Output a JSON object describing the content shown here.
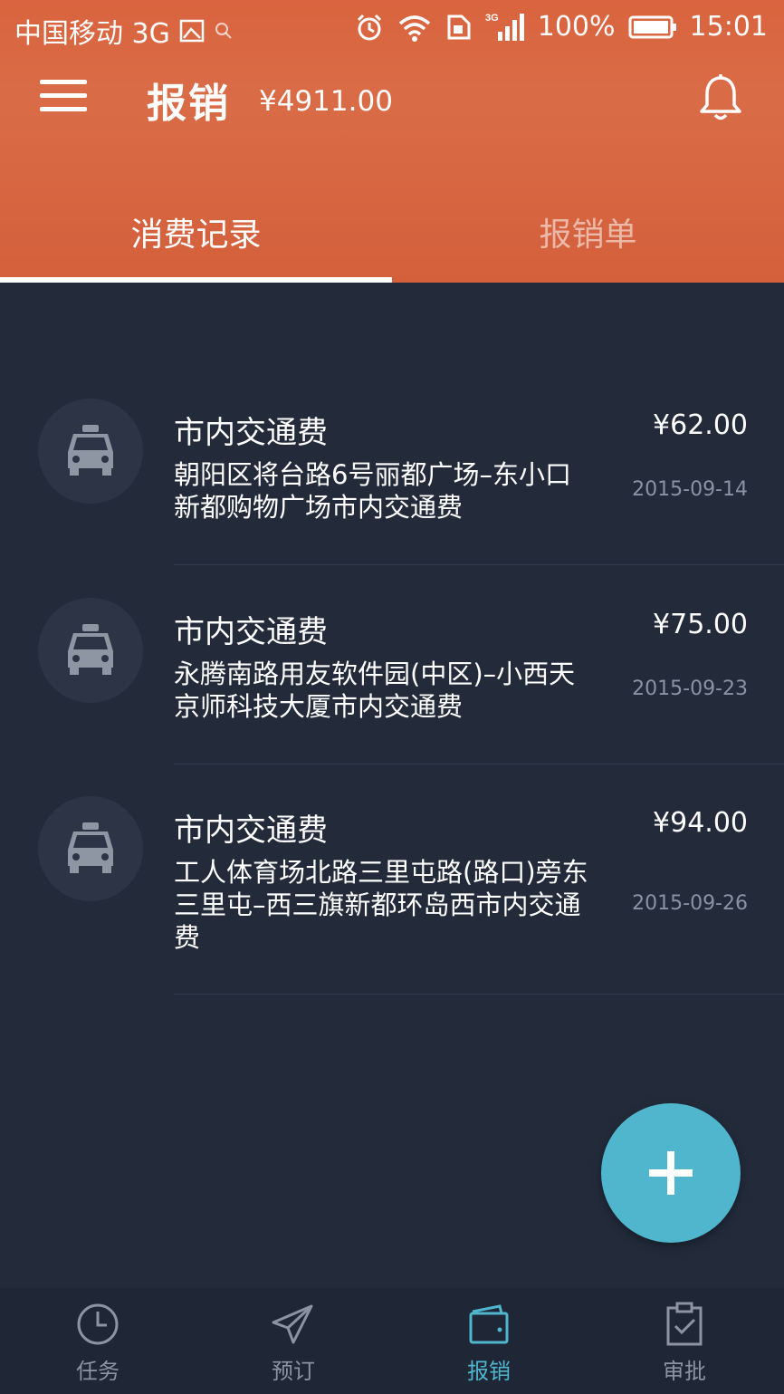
{
  "status_bar": {
    "carrier": "中国移动 3G",
    "network": "3G",
    "battery": "100%",
    "time": "15:01"
  },
  "app_bar": {
    "title": "报销",
    "amount": "¥4911.00"
  },
  "tabs": [
    {
      "label": "消费记录",
      "active": true
    },
    {
      "label": "报销单",
      "active": false
    }
  ],
  "records": [
    {
      "icon": "taxi-icon",
      "title": "市内交通费",
      "desc_line1": "朝阳区将台路6号丽都广场–东小口",
      "desc_line2": "新都购物广场市内交通费",
      "desc_line3": "",
      "amount": "¥62.00",
      "date": "2015-09-14"
    },
    {
      "icon": "taxi-icon",
      "title": "市内交通费",
      "desc_line1": "永腾南路用友软件园(中区)–小西天",
      "desc_line2": "京师科技大厦市内交通费",
      "desc_line3": "",
      "amount": "¥75.00",
      "date": "2015-09-23"
    },
    {
      "icon": "taxi-icon",
      "title": "市内交通费",
      "desc_line1": "工人体育场北路三里屯路(路口)旁东",
      "desc_line2": "三里屯–西三旗新都环岛西市内交通",
      "desc_line3": "费",
      "amount": "¥94.00",
      "date": "2015-09-26"
    }
  ],
  "fab": {
    "icon": "plus-icon"
  },
  "bottom_nav": [
    {
      "label": "任务",
      "icon": "clock-icon",
      "active": false
    },
    {
      "label": "预订",
      "icon": "paper-plane-icon",
      "active": false
    },
    {
      "label": "报销",
      "icon": "wallet-icon",
      "active": true
    },
    {
      "label": "审批",
      "icon": "clipboard-check-icon",
      "active": false
    }
  ],
  "colors": {
    "header": "#d9643e",
    "background": "#232b3b",
    "accent": "#4fb6cd",
    "muted": "#8a92a3"
  }
}
